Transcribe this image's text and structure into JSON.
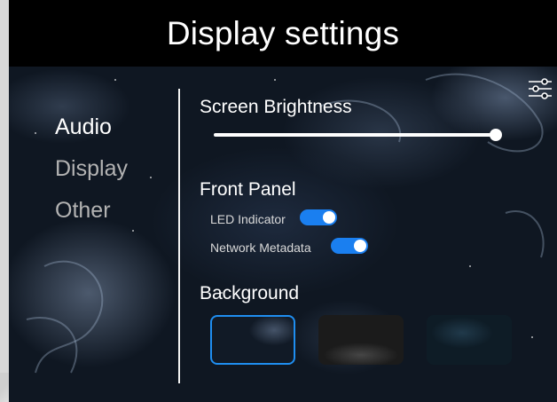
{
  "header": {
    "title": "Display settings"
  },
  "nav": {
    "items": [
      {
        "label": "Audio",
        "state": "active"
      },
      {
        "label": "Display",
        "state": "inactive"
      },
      {
        "label": "Other",
        "state": "inactive"
      }
    ]
  },
  "brightness": {
    "title": "Screen Brightness",
    "value_percent": 100
  },
  "front_panel": {
    "title": "Front Panel",
    "toggles": [
      {
        "label": "LED Indicator",
        "on": true
      },
      {
        "label": "Network Metadata",
        "on": true
      }
    ]
  },
  "background": {
    "title": "Background",
    "options": [
      {
        "name": "cosmic-swirl",
        "selected": true
      },
      {
        "name": "dark-gray",
        "selected": false
      },
      {
        "name": "deep-teal",
        "selected": false
      }
    ]
  },
  "colors": {
    "accent": "#1a7ff0",
    "header_bg": "#000000",
    "text_active": "#ffffff",
    "text_inactive": "#b3b3b3"
  },
  "icons": {
    "settings": "sliders-icon"
  }
}
